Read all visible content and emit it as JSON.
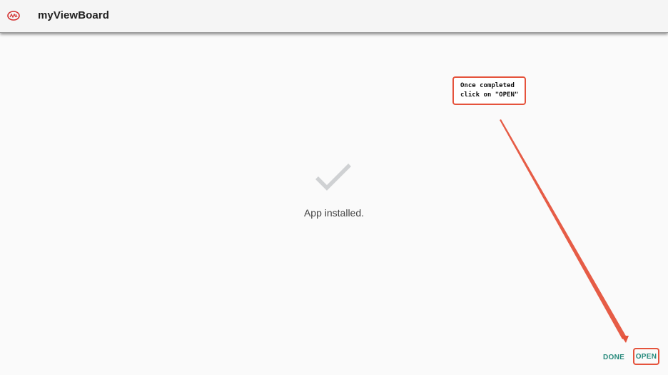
{
  "app_bar": {
    "title": "myViewBoard",
    "icon": "myviewboard-logo-icon"
  },
  "main": {
    "status_icon": "checkmark-icon",
    "status_text": "App installed."
  },
  "annotation": {
    "line1": "Once completed",
    "line2": "click on \"OPEN\""
  },
  "actions": {
    "done_label": "DONE",
    "open_label": "OPEN"
  },
  "colors": {
    "accent": "#26897b",
    "annotation": "#e5533c",
    "checkmark": "#cfd1d3"
  }
}
